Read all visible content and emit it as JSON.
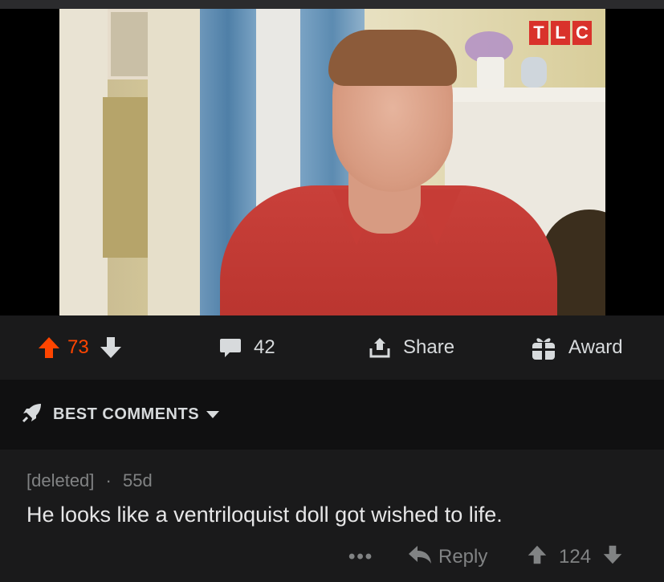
{
  "media": {
    "watermark_letters": [
      "T",
      "L",
      "C"
    ]
  },
  "post_actions": {
    "upvotes": "73",
    "comments": "42",
    "share_label": "Share",
    "award_label": "Award"
  },
  "sort": {
    "label": "BEST COMMENTS"
  },
  "comment": {
    "author": "[deleted]",
    "separator": "·",
    "age": "55d",
    "text": "He looks like a ventriloquist doll got wished to life.",
    "more_label": "•••",
    "reply_label": "Reply",
    "score": "124"
  },
  "colors": {
    "upvote_accent": "#ff4500",
    "background": "#1a1a1b",
    "muted_text": "#818384"
  }
}
